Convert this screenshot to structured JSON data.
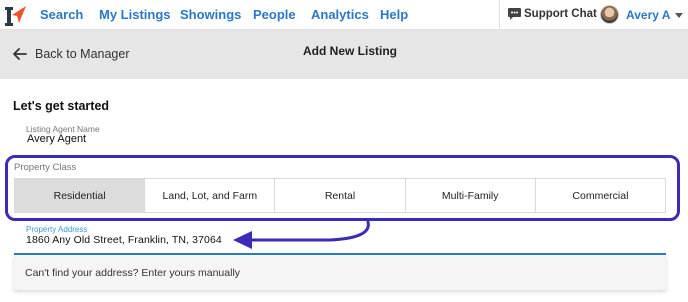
{
  "nav": {
    "items": [
      {
        "label": "Search"
      },
      {
        "label": "My Listings"
      },
      {
        "label": "Showings"
      },
      {
        "label": "People"
      },
      {
        "label": "Analytics"
      },
      {
        "label": "Help"
      }
    ],
    "support_chat": "Support Chat",
    "user_name": "Avery A",
    "colors": {
      "link": "#2b78c5",
      "logo_accent": "#e8562a",
      "logo_dark": "#2b3a4a"
    }
  },
  "header": {
    "back_label": "Back to Manager",
    "title": "Add New Listing"
  },
  "form": {
    "heading": "Let's get started",
    "listing_agent": {
      "label": "Listing Agent Name",
      "value": "Avery Agent"
    },
    "property_class": {
      "label": "Property Class",
      "options": [
        "Residential",
        "Land, Lot, and Farm",
        "Rental",
        "Multi-Family",
        "Commercial"
      ],
      "selected": "Residential"
    },
    "property_address": {
      "label": "Property Address",
      "value": "1860 Any Old Street, Franklin, TN, 37064"
    },
    "suggestion": "Can't find your address? Enter yours manually"
  },
  "annotation": {
    "highlight_color": "#3a2bb8"
  }
}
